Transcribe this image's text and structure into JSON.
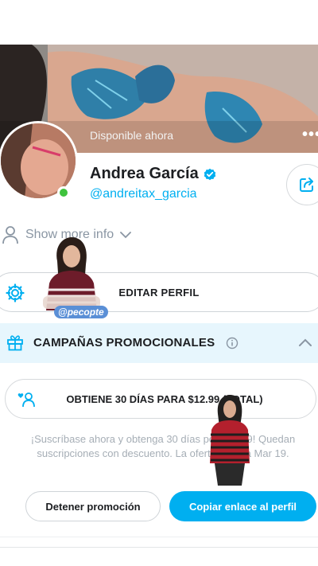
{
  "cover": {
    "status_text": "Disponible ahora",
    "more_icon": "more-dots-icon"
  },
  "profile": {
    "name": "Andrea García",
    "username": "@andreitax_garcia",
    "verified_icon": "verified-badge-icon",
    "online_color": "#3fc23d"
  },
  "show_more": {
    "label": "Show more info",
    "icon": "person-icon"
  },
  "edit_profile": {
    "label": "EDITAR PERFIL",
    "icon": "gear-icon"
  },
  "promo": {
    "title": "CAMPAÑAS PROMOCIONALES",
    "icon": "gift-icon",
    "offer_label": "OBTIENE 30 DÍAS PARA $12.99 (TOTAL)",
    "description": "¡Suscríbase ahora y obtenga 30 días por $12.99! Quedan suscripciones con descuento. La oferta finaliza Mar 19.",
    "stop_label": "Detener promoción",
    "copy_label": "Copiar enlace al perfil"
  },
  "sticker": {
    "label": "@pecopte"
  },
  "colors": {
    "accent": "#00aff0",
    "promo_bg": "#e7f6fd",
    "muted": "#8a96a3"
  }
}
